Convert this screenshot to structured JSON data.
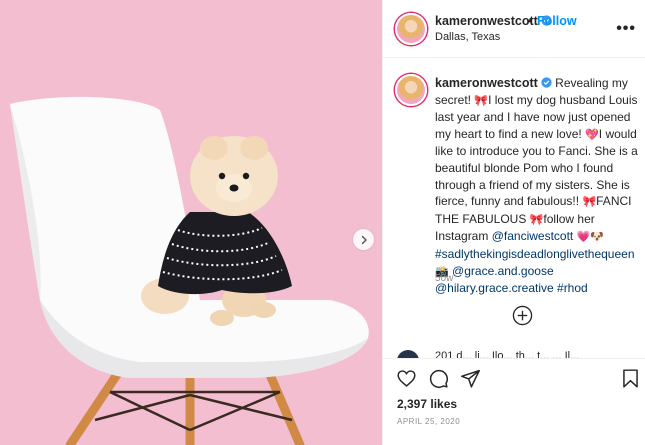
{
  "header": {
    "username": "kameronwestcott",
    "separator": "•",
    "follow_label": "Follow",
    "location": "Dallas, Texas",
    "more_label": "•••",
    "verified_icon": "verified-badge-icon",
    "more_icon": "more-options-icon"
  },
  "photo": {
    "next_icon": "chevron-right-icon",
    "description_colors": {
      "background": "#f3bfd0",
      "chair": "#ffffff",
      "legs": "#d08a45"
    }
  },
  "caption": {
    "username": "kameronwestcott",
    "text_1": "Revealing my secret!",
    "emoji_1": "🎀",
    "text_2": "I lost my dog husband Louis last year and I have now just opened my heart to find a new love!",
    "emoji_2": "💖",
    "text_3": "I would like to introduce you to Fanci. She is a beautiful blonde Pom who I found through a friend of my sisters. She is fierce, funny and fabulous!!",
    "emoji_3": "🎀",
    "text_4": "FANCI THE FABULOUS",
    "emoji_4": "🎀",
    "text_5": "follow her Instagram",
    "mention_1": "@fanciwestcott",
    "emoji_5": "💗🐶",
    "hashtag_1": "#sadlythekingisdeadlonglivethequeen",
    "emoji_6": "📸",
    "mention_2": "@grace.and.goose",
    "mention_3": "@hilary.grace.creative",
    "hashtag_2": "#rhod",
    "time_ago": "50w"
  },
  "comments": {
    "load_more_icon": "plus-circle-icon",
    "next_comment_preview": "201 d... li... Ilo... th... t... ... Il..."
  },
  "actions": {
    "like_icon": "heart-icon",
    "comment_icon": "comment-icon",
    "share_icon": "share-icon",
    "save_icon": "bookmark-icon",
    "likes": "2,397 likes",
    "date": "APRIL 25, 2020"
  },
  "colors": {
    "link": "#0095f6",
    "mention": "#00376b",
    "muted": "#8e8e8e",
    "border": "#efefef"
  }
}
